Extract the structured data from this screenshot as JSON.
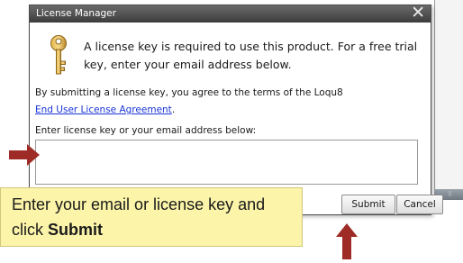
{
  "dialog": {
    "title": "License Manager",
    "close_icon": "close-icon",
    "message": "A license key is required to use this product.  For a free trial key, enter your email address below.",
    "agreement_text": "By submitting a license key, you agree to the terms of the Loqu8",
    "eula_link": "End User License Agreement",
    "eula_suffix": ".",
    "instruction": "Enter license key or your email address below:",
    "input_value": "",
    "submit_label": "Submit",
    "cancel_label": "Cancel",
    "icon": "key-icon"
  },
  "callout": {
    "text_prefix": "Enter your email or license key and click ",
    "text_bold": "Submit"
  },
  "colors": {
    "arrow": "#9e2b25",
    "callout_bg": "#fbf4a9",
    "title_bar": "#4a4a4a",
    "link": "#1a35d8"
  }
}
